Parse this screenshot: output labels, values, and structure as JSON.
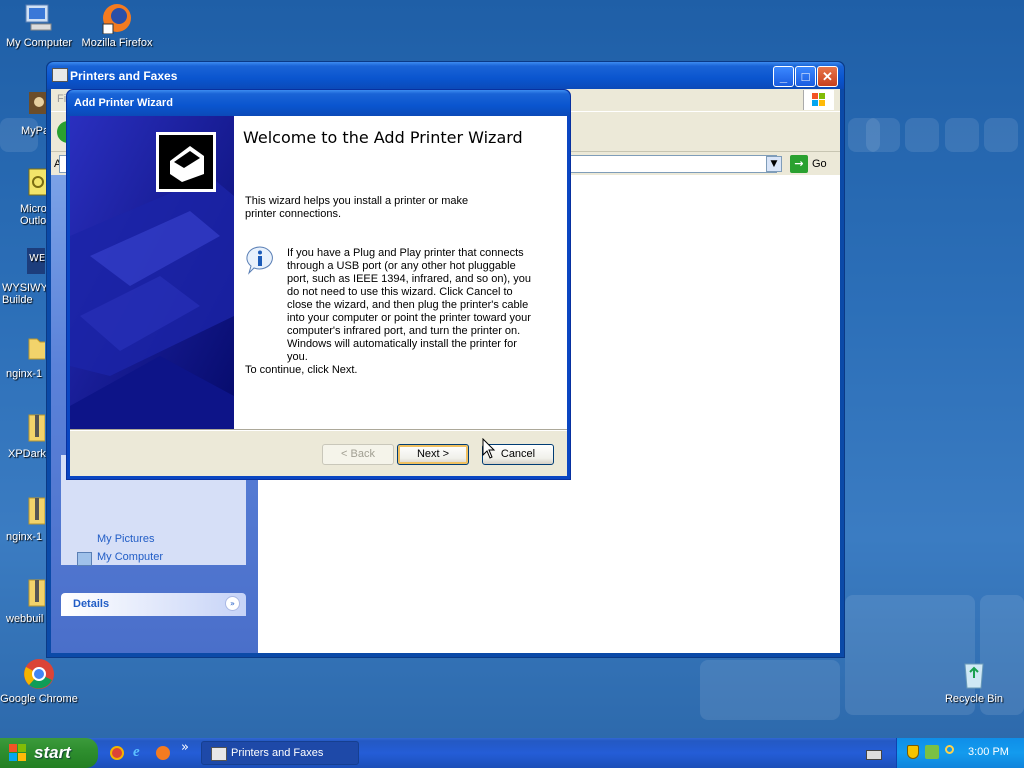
{
  "desktop": {
    "icons": [
      {
        "label": "My Computer"
      },
      {
        "label": "Mozilla Firefox"
      },
      {
        "label": "MyPa"
      },
      {
        "label": "Micros Outlo"
      },
      {
        "label": "WYSIWY Builde"
      },
      {
        "label": "nginx-1"
      },
      {
        "label": "XPDarkl"
      },
      {
        "label": "nginx-1"
      },
      {
        "label": "webbuil"
      },
      {
        "label": "Google Chrome"
      },
      {
        "label": "Recycle Bin"
      }
    ]
  },
  "printers_window": {
    "title": "Printers and Faxes",
    "address_label": "Ad",
    "go_label": "Go",
    "menu_stub": "Fi",
    "tasks": {
      "my_pictures": "My Pictures",
      "my_computer": "My Computer"
    },
    "details_header": "Details"
  },
  "wizard": {
    "title": "Add Printer Wizard",
    "heading": "Welcome to the Add Printer Wizard",
    "intro": "This wizard helps you install a printer or make printer connections.",
    "info": "If you have a Plug and Play printer that connects through a USB port (or any other hot pluggable port, such as IEEE 1394, infrared, and so on), you do not need to use this wizard. Click Cancel to close the wizard, and then plug the printer's cable into your computer or point the printer toward your computer's infrared port, and turn the printer on. Windows will automatically install the printer for you.",
    "continue": "To continue, click Next.",
    "buttons": {
      "back": "< Back",
      "next": "Next >",
      "cancel": "Cancel"
    }
  },
  "taskbar": {
    "start": "start",
    "task_button": "Printers and Faxes",
    "overflow": "»",
    "clock": "3:00 PM"
  }
}
